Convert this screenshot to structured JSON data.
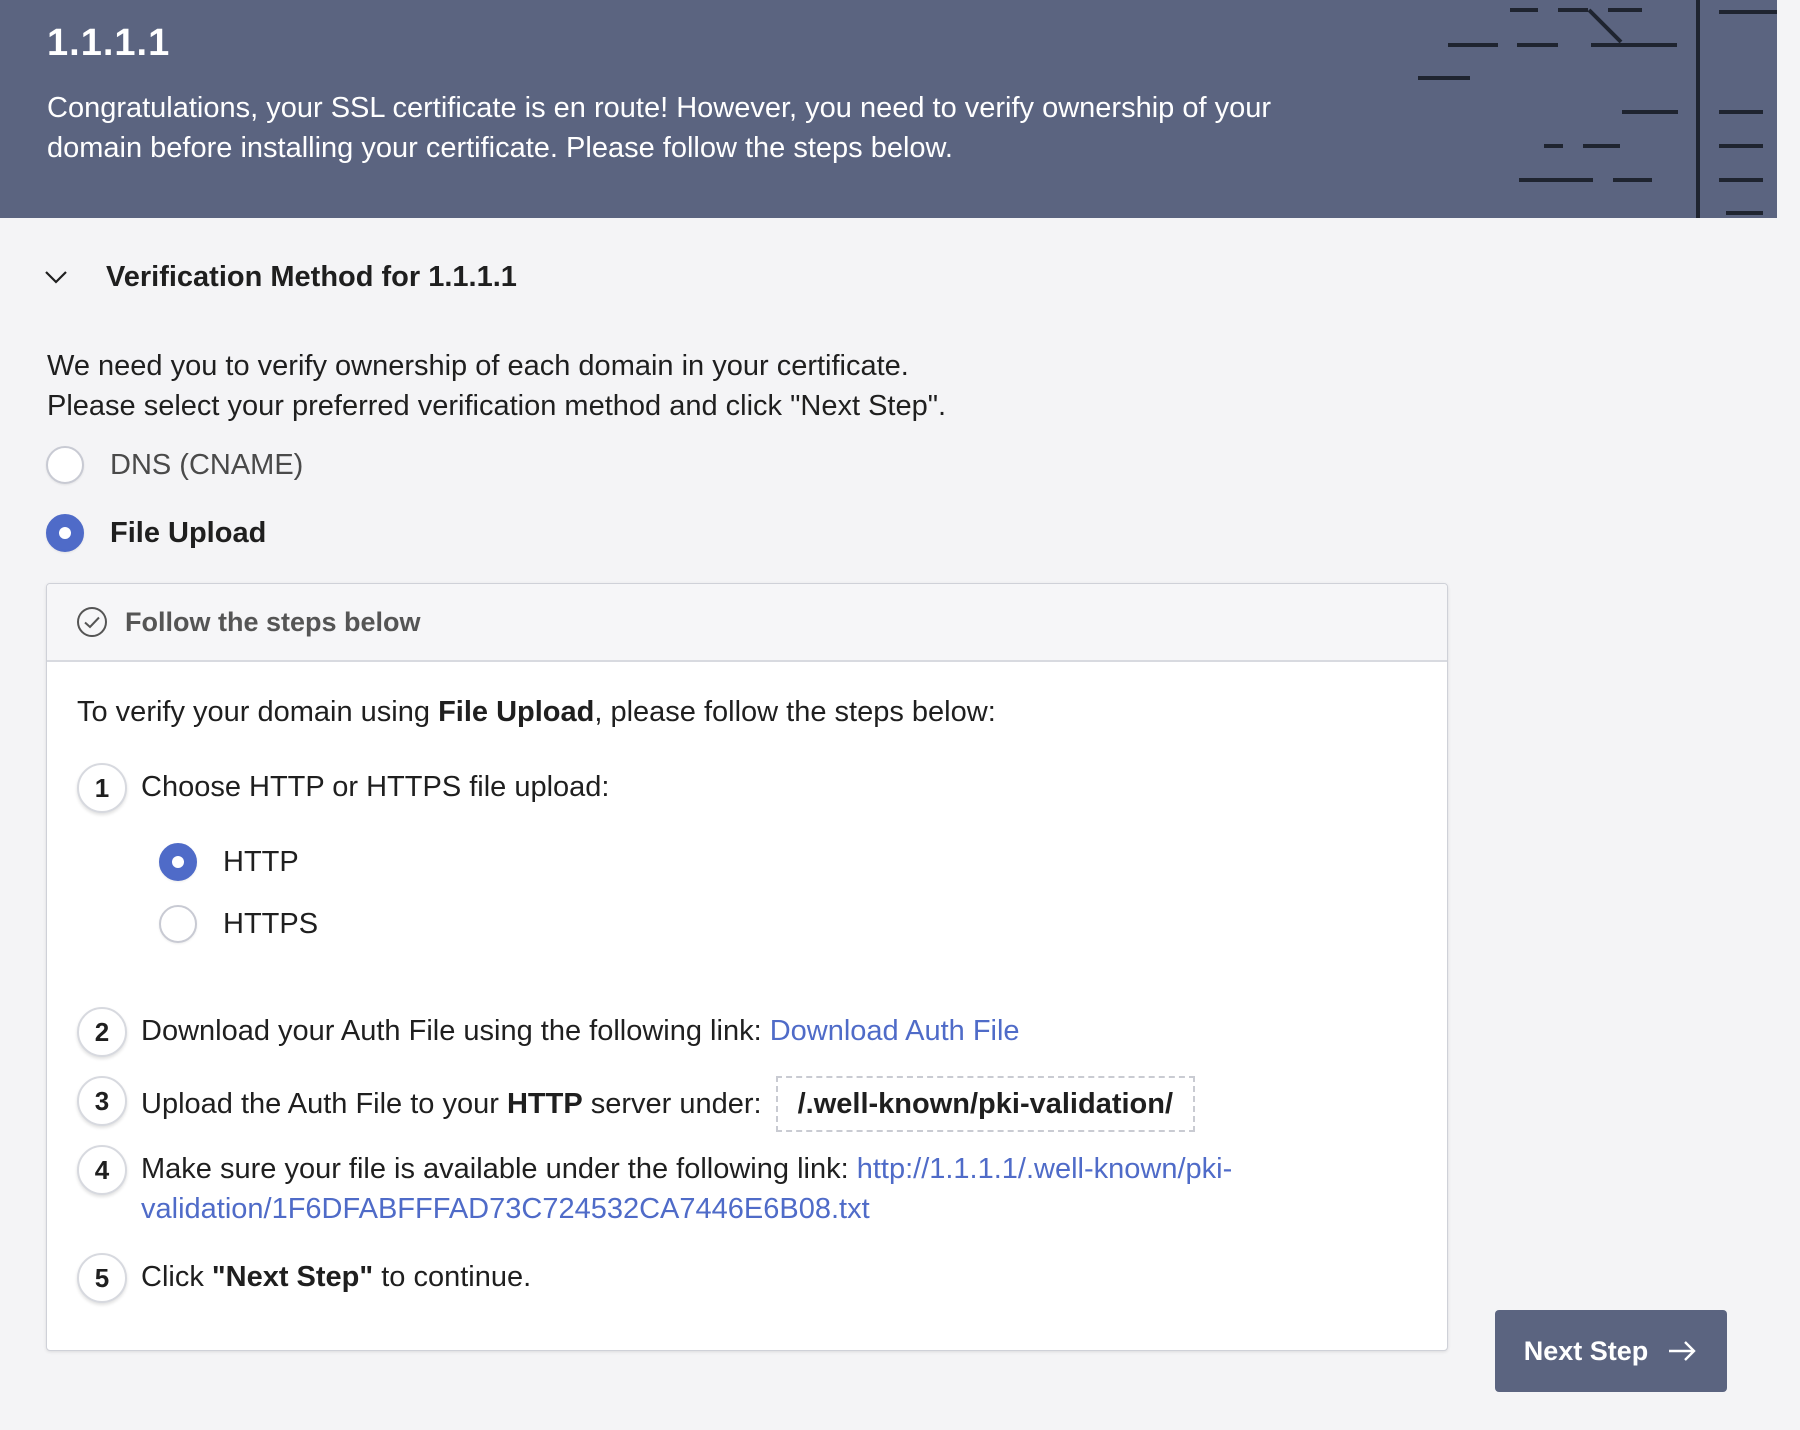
{
  "banner": {
    "title": "1.1.1.1",
    "message": "Congratulations, your SSL certificate is en route! However, you need to verify ownership of your domain before installing your certificate. Please follow the steps below."
  },
  "verification": {
    "title": "Verification Method for 1.1.1.1",
    "intro_line1": "We need you to verify ownership of each domain in your certificate.",
    "intro_line2": "Please select your preferred verification method and click \"Next Step\".",
    "methods": [
      {
        "label": "DNS (CNAME)",
        "selected": false
      },
      {
        "label": "File Upload",
        "selected": true
      }
    ]
  },
  "panel": {
    "header": "Follow the steps below",
    "intro_prefix": "To verify your domain using ",
    "intro_method": "File Upload",
    "intro_suffix": ", please follow the steps below:",
    "steps": [
      {
        "number": "1",
        "text": "Choose HTTP or HTTPS file upload:"
      },
      {
        "number": "2",
        "text": "Download your Auth File using the following link: ",
        "link": "Download Auth File"
      },
      {
        "number": "3",
        "prefix": "Upload the Auth File to your ",
        "protocol": "HTTP",
        "suffix": " server under:",
        "path": "/.well-known/pki-validation/"
      },
      {
        "number": "4",
        "text": "Make sure your file is available under the following link: ",
        "link_line1": "http://1.1.1.1/.well-known/pki-",
        "link_line2": "validation/1F6DFABFFFAD73C724532CA7446E6B08.txt"
      },
      {
        "number": "5",
        "prefix": "Click ",
        "emphasis": "\"Next Step\"",
        "suffix": " to continue."
      }
    ],
    "protocols": [
      {
        "label": "HTTP",
        "selected": true
      },
      {
        "label": "HTTPS",
        "selected": false
      }
    ]
  },
  "actions": {
    "next_label": "Next Step"
  },
  "colors": {
    "banner_bg": "#5b6480",
    "accent": "#4f6bc8",
    "page_bg": "#f4f4f6"
  },
  "icons": [
    "chevron-down-icon",
    "check-circle-icon",
    "arrow-right-icon"
  ]
}
